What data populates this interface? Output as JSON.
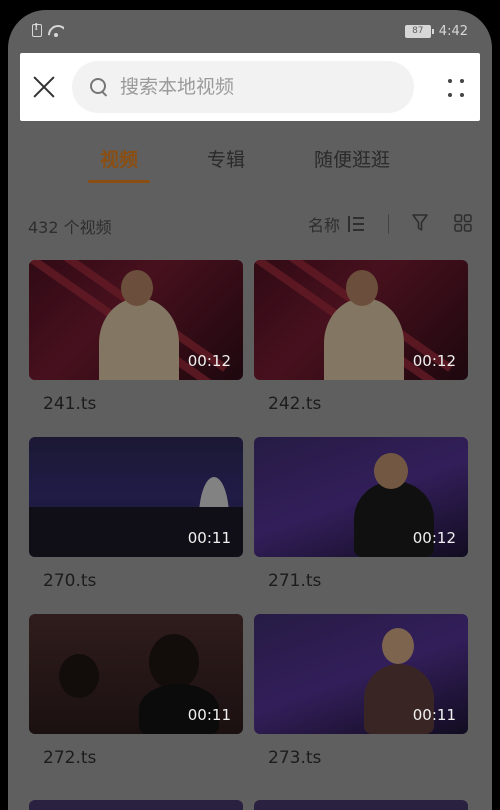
{
  "status_bar": {
    "time": "4:42",
    "battery": "87",
    "sim_icon": "sim-alert-icon",
    "wifi_icon": "wifi-icon"
  },
  "search": {
    "placeholder": "搜索本地视频"
  },
  "tabs": [
    {
      "label": "视频",
      "active": true
    },
    {
      "label": "专辑",
      "active": false
    },
    {
      "label": "随便逛逛",
      "active": false
    }
  ],
  "toolbar": {
    "count_label": "432 个视频",
    "sort_label": "名称"
  },
  "videos": [
    {
      "name": "241.ts",
      "duration": "00:12"
    },
    {
      "name": "242.ts",
      "duration": "00:12"
    },
    {
      "name": "270.ts",
      "duration": "00:11"
    },
    {
      "name": "271.ts",
      "duration": "00:12"
    },
    {
      "name": "272.ts",
      "duration": "00:11"
    },
    {
      "name": "273.ts",
      "duration": "00:11"
    }
  ],
  "colors": {
    "accent": "#8a4e12",
    "overlay": "#5f5f5f"
  }
}
